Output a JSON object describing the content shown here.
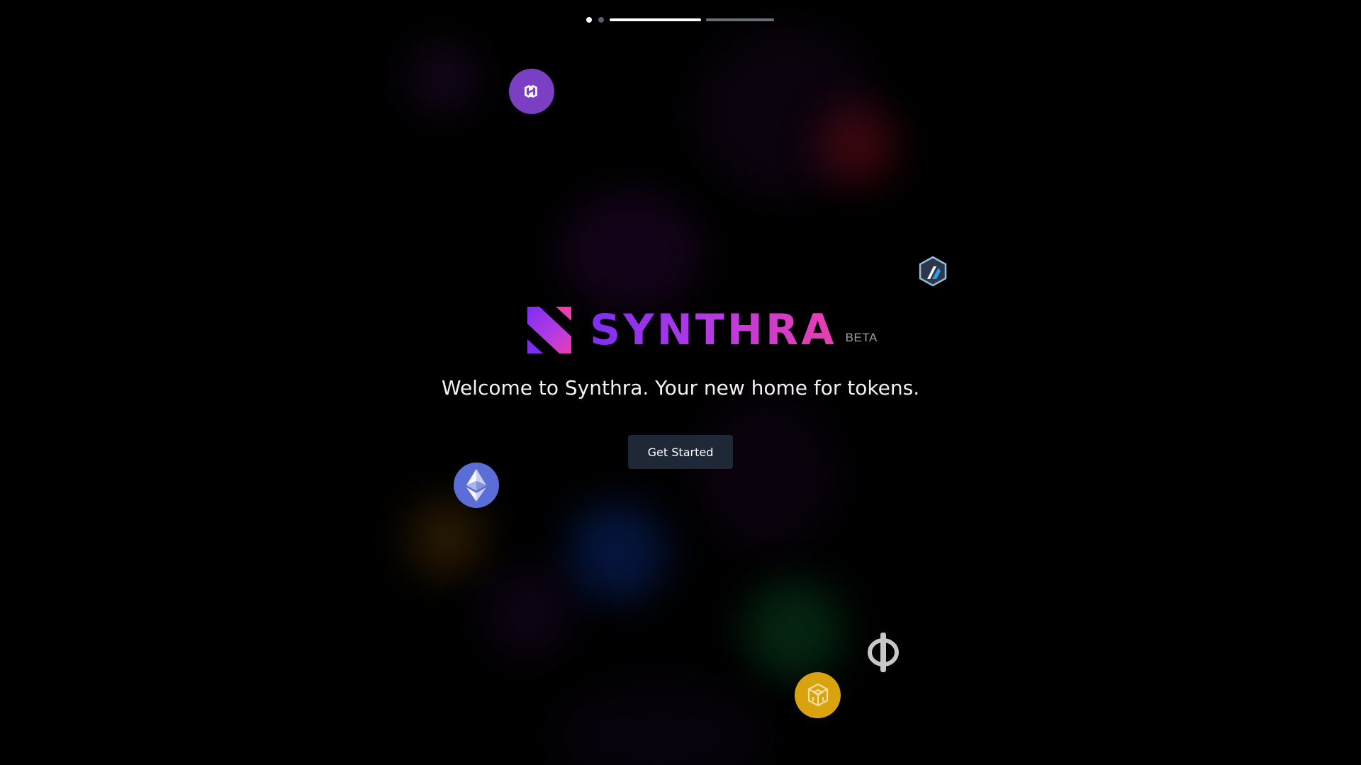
{
  "progress": {
    "dots": 2,
    "active_dot": 1,
    "bars": [
      {
        "fill": 1.0
      },
      {
        "fill": 0.0
      }
    ]
  },
  "brand": {
    "name": "SYNTHRA",
    "badge": "BETA",
    "gradient": [
      "#7d2ff0",
      "#b23ae6",
      "#e93fae"
    ]
  },
  "hero": {
    "welcome": "Welcome to Synthra. Your new home for tokens."
  },
  "cta": {
    "label": "Get Started",
    "background": "#1e2836"
  },
  "tokens": [
    {
      "name": "polygon-icon",
      "color": "#7b3fc4"
    },
    {
      "name": "arbitrum-icon",
      "color": "#2d374b"
    },
    {
      "name": "ethereum-icon",
      "color": "#5b6ed6"
    },
    {
      "name": "bnb-icon",
      "color": "#d9a20f"
    },
    {
      "name": "phi-icon",
      "color": "#c8c8c8"
    }
  ]
}
